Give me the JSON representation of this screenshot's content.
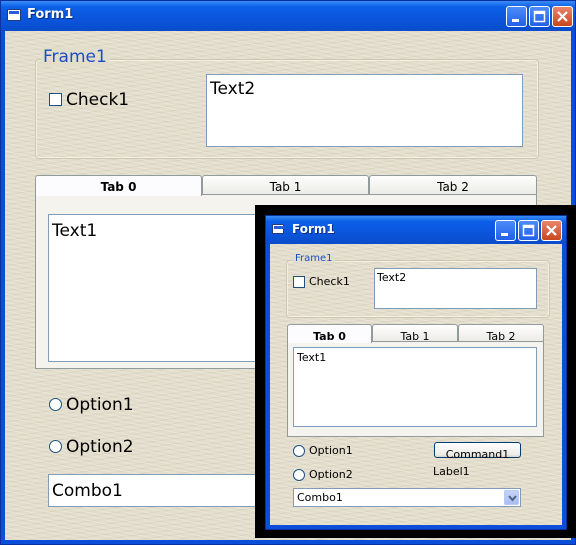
{
  "main_window": {
    "title": "Form1",
    "frame_caption": "Frame1",
    "check_label": "Check1",
    "text2_value": "Text2",
    "tabs": [
      {
        "label": "Tab 0"
      },
      {
        "label": "Tab 1"
      },
      {
        "label": "Tab 2"
      }
    ],
    "text1_value": "Text1",
    "option1_label": "Option1",
    "option2_label": "Option2",
    "combo_value": "Combo1"
  },
  "inner_window": {
    "title": "Form1",
    "frame_caption": "Frame1",
    "check_label": "Check1",
    "text2_value": "Text2",
    "tabs": [
      {
        "label": "Tab 0"
      },
      {
        "label": "Tab 1"
      },
      {
        "label": "Tab 2"
      }
    ],
    "text1_value": "Text1",
    "option1_label": "Option1",
    "option2_label": "Option2",
    "command_label": "Command1",
    "label1_text": "Label1",
    "combo_value": "Combo1"
  },
  "icons": {
    "app": "form-window-icon",
    "minimize": "minimize-icon",
    "maximize": "maximize-icon",
    "close": "close-icon",
    "dropdown": "chevron-down-icon"
  },
  "colors": {
    "titlebar": "#0b56dd",
    "frame_caption": "#1a4fc4",
    "close_button": "#c9461f"
  }
}
